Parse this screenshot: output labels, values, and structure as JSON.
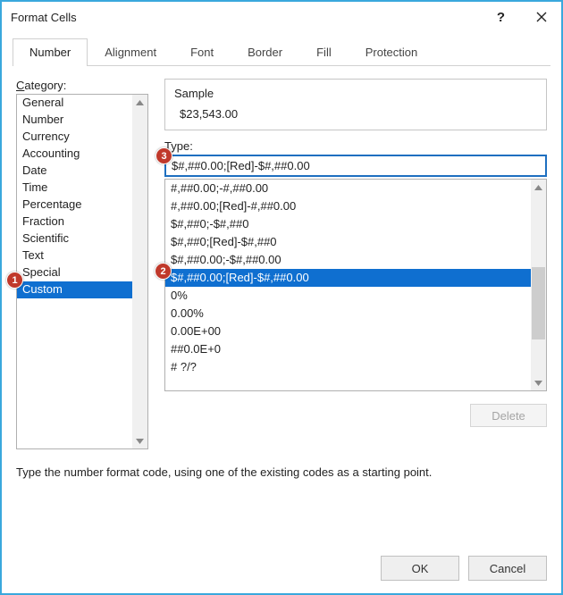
{
  "window": {
    "title": "Format Cells"
  },
  "tabs": {
    "items": [
      "Number",
      "Alignment",
      "Font",
      "Border",
      "Fill",
      "Protection"
    ],
    "active_index": 0
  },
  "category": {
    "label": "Category:",
    "items": [
      "General",
      "Number",
      "Currency",
      "Accounting",
      "Date",
      "Time",
      "Percentage",
      "Fraction",
      "Scientific",
      "Text",
      "Special",
      "Custom"
    ],
    "selected_index": 11
  },
  "sample": {
    "label": "Sample",
    "value": "$23,543.00"
  },
  "type": {
    "label": "Type:",
    "input_value": "$#,##0.00;[Red]-$#,##0.00",
    "items": [
      "#,##0.00;-#,##0.00",
      "#,##0.00;[Red]-#,##0.00",
      "$#,##0;-$#,##0",
      "$#,##0;[Red]-$#,##0",
      "$#,##0.00;-$#,##0.00",
      "$#,##0.00;[Red]-$#,##0.00",
      "0%",
      "0.00%",
      "0.00E+00",
      "##0.0E+0",
      "# ?/?"
    ],
    "selected_index": 5
  },
  "buttons": {
    "delete": "Delete",
    "ok": "OK",
    "cancel": "Cancel"
  },
  "hint": "Type the number format code, using one of the existing codes as a starting point.",
  "annotations": {
    "a1": "1",
    "a2": "2",
    "a3": "3"
  }
}
